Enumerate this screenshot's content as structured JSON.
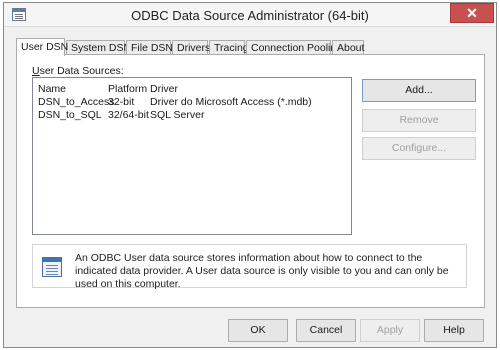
{
  "window": {
    "title": "ODBC Data Source Administrator (64-bit)",
    "close_glyph": "✕"
  },
  "tabs": [
    {
      "label": "User DSN"
    },
    {
      "label": "System DSN"
    },
    {
      "label": "File DSN"
    },
    {
      "label": "Drivers"
    },
    {
      "label": "Tracing"
    },
    {
      "label": "Connection Pooling"
    },
    {
      "label": "About"
    }
  ],
  "user_dsn": {
    "section_label_prefix": "U",
    "section_label_rest": "ser Data Sources:",
    "columns": [
      "Name",
      "Platform",
      "Driver"
    ],
    "rows": [
      {
        "name": "DSN_to_Access",
        "platform": "32-bit",
        "driver": "Driver do Microsoft Access (*.mdb)"
      },
      {
        "name": "DSN_to_SQL",
        "platform": "32/64-bit",
        "driver": "SQL Server"
      }
    ],
    "add_label": "Add...",
    "remove_label": "Remove",
    "configure_label": "Configure...",
    "info_text": "An ODBC User data source stores information about how to connect to the indicated data provider.  A User data source is only visible to you and can only be used on this computer."
  },
  "footer": {
    "ok": "OK",
    "cancel": "Cancel",
    "apply": "Apply",
    "help": "Help"
  }
}
